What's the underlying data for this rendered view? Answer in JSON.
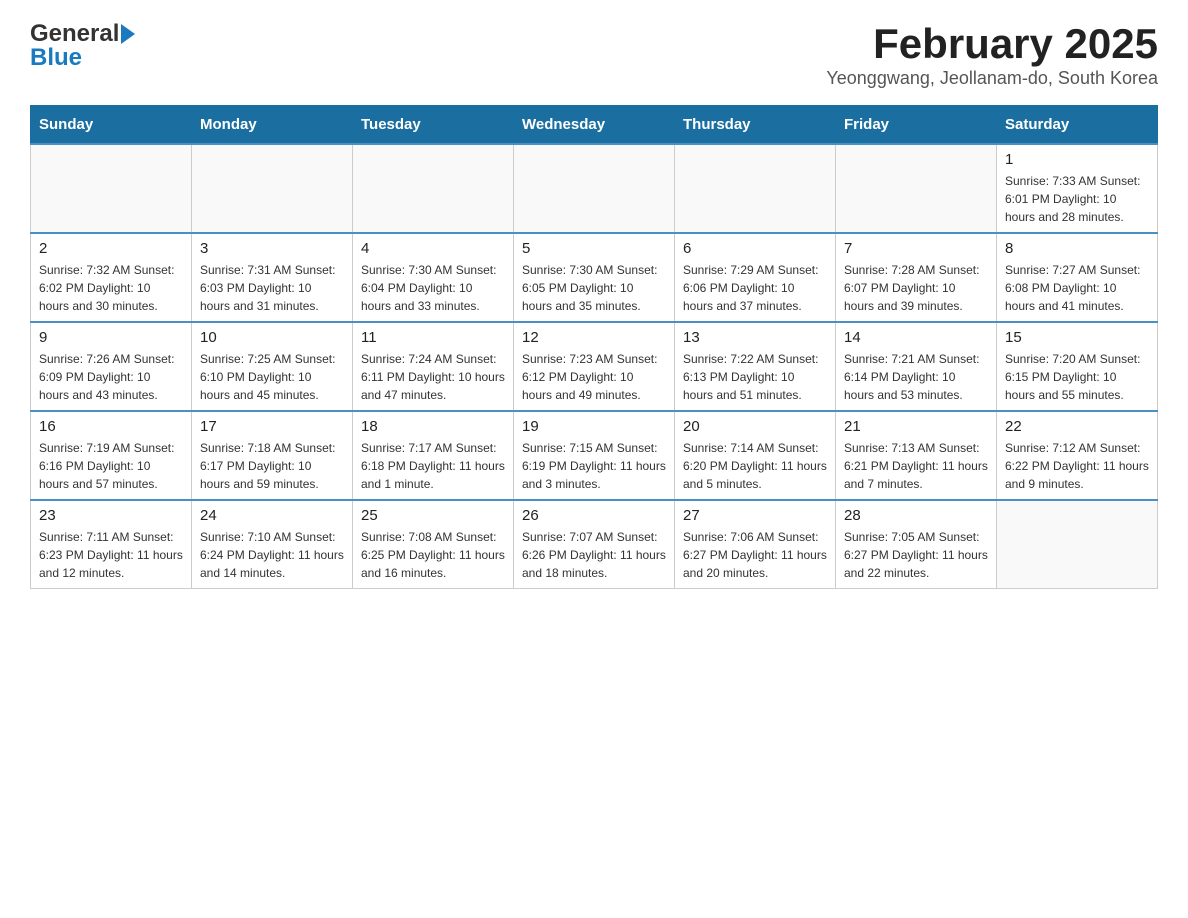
{
  "header": {
    "logo_general": "General",
    "logo_blue": "Blue",
    "month_title": "February 2025",
    "location": "Yeonggwang, Jeollanam-do, South Korea"
  },
  "days_of_week": [
    "Sunday",
    "Monday",
    "Tuesday",
    "Wednesday",
    "Thursday",
    "Friday",
    "Saturday"
  ],
  "weeks": [
    [
      {
        "day": "",
        "info": ""
      },
      {
        "day": "",
        "info": ""
      },
      {
        "day": "",
        "info": ""
      },
      {
        "day": "",
        "info": ""
      },
      {
        "day": "",
        "info": ""
      },
      {
        "day": "",
        "info": ""
      },
      {
        "day": "1",
        "info": "Sunrise: 7:33 AM\nSunset: 6:01 PM\nDaylight: 10 hours and 28 minutes."
      }
    ],
    [
      {
        "day": "2",
        "info": "Sunrise: 7:32 AM\nSunset: 6:02 PM\nDaylight: 10 hours and 30 minutes."
      },
      {
        "day": "3",
        "info": "Sunrise: 7:31 AM\nSunset: 6:03 PM\nDaylight: 10 hours and 31 minutes."
      },
      {
        "day": "4",
        "info": "Sunrise: 7:30 AM\nSunset: 6:04 PM\nDaylight: 10 hours and 33 minutes."
      },
      {
        "day": "5",
        "info": "Sunrise: 7:30 AM\nSunset: 6:05 PM\nDaylight: 10 hours and 35 minutes."
      },
      {
        "day": "6",
        "info": "Sunrise: 7:29 AM\nSunset: 6:06 PM\nDaylight: 10 hours and 37 minutes."
      },
      {
        "day": "7",
        "info": "Sunrise: 7:28 AM\nSunset: 6:07 PM\nDaylight: 10 hours and 39 minutes."
      },
      {
        "day": "8",
        "info": "Sunrise: 7:27 AM\nSunset: 6:08 PM\nDaylight: 10 hours and 41 minutes."
      }
    ],
    [
      {
        "day": "9",
        "info": "Sunrise: 7:26 AM\nSunset: 6:09 PM\nDaylight: 10 hours and 43 minutes."
      },
      {
        "day": "10",
        "info": "Sunrise: 7:25 AM\nSunset: 6:10 PM\nDaylight: 10 hours and 45 minutes."
      },
      {
        "day": "11",
        "info": "Sunrise: 7:24 AM\nSunset: 6:11 PM\nDaylight: 10 hours and 47 minutes."
      },
      {
        "day": "12",
        "info": "Sunrise: 7:23 AM\nSunset: 6:12 PM\nDaylight: 10 hours and 49 minutes."
      },
      {
        "day": "13",
        "info": "Sunrise: 7:22 AM\nSunset: 6:13 PM\nDaylight: 10 hours and 51 minutes."
      },
      {
        "day": "14",
        "info": "Sunrise: 7:21 AM\nSunset: 6:14 PM\nDaylight: 10 hours and 53 minutes."
      },
      {
        "day": "15",
        "info": "Sunrise: 7:20 AM\nSunset: 6:15 PM\nDaylight: 10 hours and 55 minutes."
      }
    ],
    [
      {
        "day": "16",
        "info": "Sunrise: 7:19 AM\nSunset: 6:16 PM\nDaylight: 10 hours and 57 minutes."
      },
      {
        "day": "17",
        "info": "Sunrise: 7:18 AM\nSunset: 6:17 PM\nDaylight: 10 hours and 59 minutes."
      },
      {
        "day": "18",
        "info": "Sunrise: 7:17 AM\nSunset: 6:18 PM\nDaylight: 11 hours and 1 minute."
      },
      {
        "day": "19",
        "info": "Sunrise: 7:15 AM\nSunset: 6:19 PM\nDaylight: 11 hours and 3 minutes."
      },
      {
        "day": "20",
        "info": "Sunrise: 7:14 AM\nSunset: 6:20 PM\nDaylight: 11 hours and 5 minutes."
      },
      {
        "day": "21",
        "info": "Sunrise: 7:13 AM\nSunset: 6:21 PM\nDaylight: 11 hours and 7 minutes."
      },
      {
        "day": "22",
        "info": "Sunrise: 7:12 AM\nSunset: 6:22 PM\nDaylight: 11 hours and 9 minutes."
      }
    ],
    [
      {
        "day": "23",
        "info": "Sunrise: 7:11 AM\nSunset: 6:23 PM\nDaylight: 11 hours and 12 minutes."
      },
      {
        "day": "24",
        "info": "Sunrise: 7:10 AM\nSunset: 6:24 PM\nDaylight: 11 hours and 14 minutes."
      },
      {
        "day": "25",
        "info": "Sunrise: 7:08 AM\nSunset: 6:25 PM\nDaylight: 11 hours and 16 minutes."
      },
      {
        "day": "26",
        "info": "Sunrise: 7:07 AM\nSunset: 6:26 PM\nDaylight: 11 hours and 18 minutes."
      },
      {
        "day": "27",
        "info": "Sunrise: 7:06 AM\nSunset: 6:27 PM\nDaylight: 11 hours and 20 minutes."
      },
      {
        "day": "28",
        "info": "Sunrise: 7:05 AM\nSunset: 6:27 PM\nDaylight: 11 hours and 22 minutes."
      },
      {
        "day": "",
        "info": ""
      }
    ]
  ]
}
